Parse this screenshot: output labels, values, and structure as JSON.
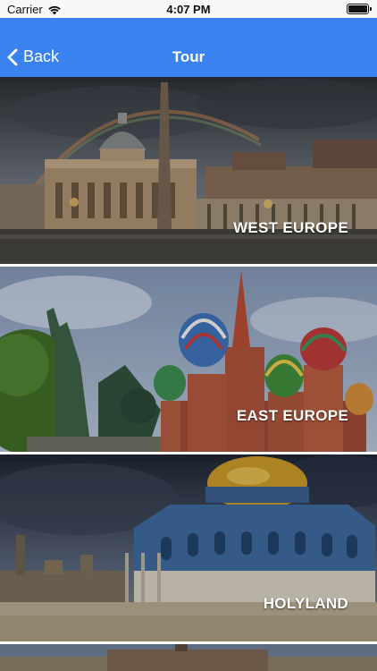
{
  "status_bar": {
    "carrier": "Carrier",
    "time": "4:07 PM"
  },
  "nav": {
    "back_label": "Back",
    "title": "Tour"
  },
  "tours": [
    {
      "label": "WEST EUROPE"
    },
    {
      "label": "EAST EUROPE"
    },
    {
      "label": "HOLYLAND"
    }
  ],
  "colors": {
    "nav_background": "#3b82f1",
    "status_background": "#f8f8f8"
  }
}
